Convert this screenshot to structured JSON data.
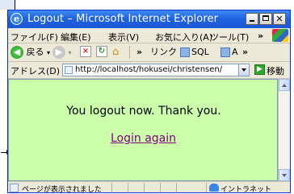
{
  "window": {
    "title": "Logout – Microsoft Internet Explorer",
    "title_icon": "ie-icon"
  },
  "menu": {
    "items": [
      "ファイル(F)",
      "編集(E)",
      "表示(V)",
      "お気に入り(A)",
      "ツール(T)"
    ],
    "more": "»"
  },
  "toolbar": {
    "back_label": "戻る",
    "links_label": "リンク",
    "link_items": [
      "SQL",
      "A"
    ],
    "more": "»"
  },
  "address": {
    "label": "アドレス(D)",
    "value": "http://localhost/hokusei/christensen/",
    "go_label": "移動"
  },
  "page": {
    "message": "You logout now. Thank you.",
    "login_link": "Login again",
    "background": "#ccffaa",
    "visited_link_color": "#800080"
  },
  "status": {
    "text": "ページが表示されました",
    "zone": "イントラネット"
  }
}
